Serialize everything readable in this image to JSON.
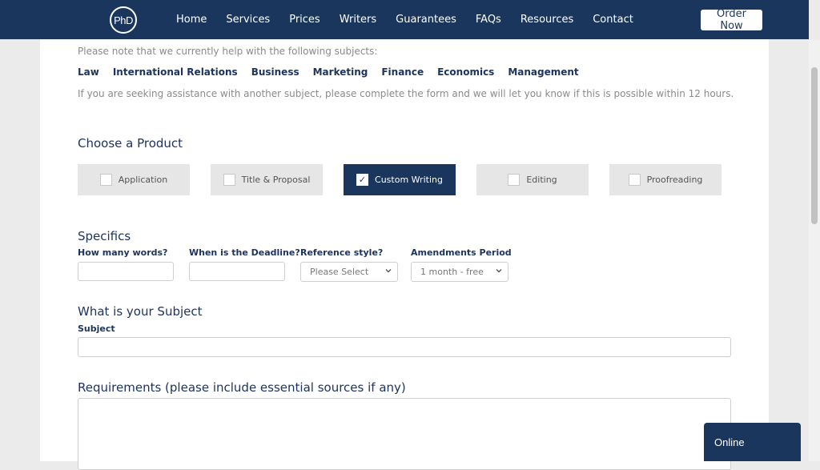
{
  "nav": {
    "logo_text": "PhD",
    "links": [
      "Home",
      "Services",
      "Prices",
      "Writers",
      "Guarantees",
      "FAQs",
      "Resources",
      "Contact"
    ],
    "order_button": "Order Now"
  },
  "subjects_note": "Please note that we currently help with the following subjects:",
  "subjects": [
    "Law",
    "International Relations",
    "Business",
    "Marketing",
    "Finance",
    "Economics",
    "Management"
  ],
  "other_subject_note": "If you are seeking assistance with another subject, please complete the form and we will let you know if this is possible within 12 hours.",
  "choose_product": {
    "title": "Choose a Product",
    "products": [
      {
        "label": "Application",
        "checked": false
      },
      {
        "label": "Title & Proposal",
        "checked": false
      },
      {
        "label": "Custom Writing",
        "checked": true
      },
      {
        "label": "Editing",
        "checked": false
      },
      {
        "label": "Proofreading",
        "checked": false
      }
    ]
  },
  "specifics": {
    "title": "Specifics",
    "words_label": "How many words?",
    "words_value": "",
    "deadline_label": "When is the Deadline?",
    "deadline_value": "",
    "reference_label": "Reference style?",
    "reference_selected": "Please Select",
    "amendments_label": "Amendments Period",
    "amendments_selected": "1 month - free"
  },
  "subject_section": {
    "title": "What is your Subject",
    "field_label": "Subject",
    "value": ""
  },
  "requirements": {
    "title": "Requirements (please include essential sources if any)",
    "value": ""
  },
  "chat": {
    "label": "Online"
  },
  "colors": {
    "navy": "#1b365d",
    "product_bg": "#e6e6e6",
    "page_bg": "#ebebeb"
  }
}
